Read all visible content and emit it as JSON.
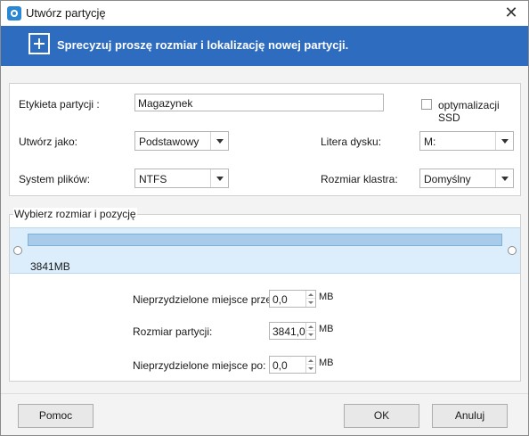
{
  "window": {
    "title": "Utwórz partycję",
    "close_glyph": "✕"
  },
  "banner": {
    "text": "Sprecyzuj proszę rozmiar i lokalizację nowej partycji."
  },
  "form": {
    "partition_label_caption": "Etykieta partycji :",
    "partition_label_value": "Magazynek",
    "ssd_optimization_caption": "optymalizacji SSD",
    "ssd_optimization_checked": false,
    "create_as_caption": "Utwórz jako:",
    "create_as_value": "Podstawowy",
    "drive_letter_caption": "Litera dysku:",
    "drive_letter_value": "M:",
    "file_system_caption": "System plików:",
    "file_system_value": "NTFS",
    "cluster_size_caption": "Rozmiar klastra:",
    "cluster_size_value": "Domyślny"
  },
  "size_position": {
    "group_title": "Wybierz rozmiar i pozycję",
    "partition_size_display": "3841MB",
    "unallocated_before_caption": "Nieprzydzielone miejsce przed:",
    "unallocated_before_value": "0,0",
    "partition_size_caption": "Rozmiar partycji:",
    "partition_size_value": "3841,0",
    "unallocated_after_caption": "Nieprzydzielone miejsce po:",
    "unallocated_after_value": "0,0",
    "unit": "MB"
  },
  "buttons": {
    "help": "Pomoc",
    "ok": "OK",
    "cancel": "Anuluj"
  },
  "colors": {
    "banner": "#2e6cc0",
    "track": "#a7cbe8"
  }
}
